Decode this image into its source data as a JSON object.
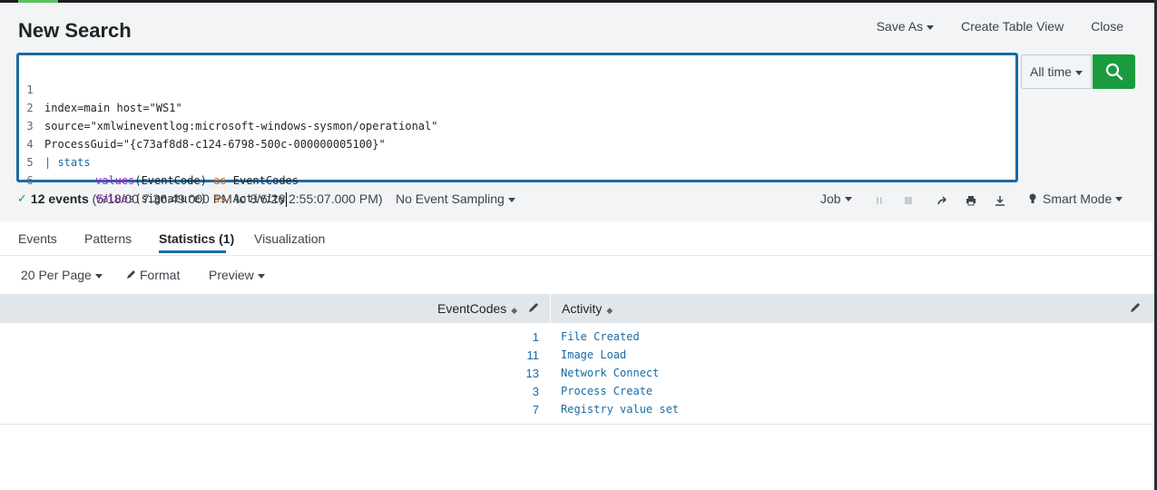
{
  "header": {
    "title": "New Search",
    "save_as": "Save As",
    "create_table_view": "Create Table View",
    "close": "Close"
  },
  "search": {
    "lines": [
      {
        "num": "1",
        "text": "index=main host=\"WS1\""
      },
      {
        "num": "2",
        "text": "source=\"xmlwineventlog:microsoft-windows-sysmon/operational\""
      },
      {
        "num": "3",
        "text": "ProcessGuid=\"{c73af8d8-c124-6798-500c-000000005100}\""
      },
      {
        "num": "4",
        "pipe": "| ",
        "cmd": "stats"
      },
      {
        "num": "5",
        "fn": "values",
        "arg": "(EventCode) ",
        "as": "as",
        "alias": " EventCodes"
      },
      {
        "num": "6",
        "fn": "values",
        "arg": "(signature) ",
        "as": "as",
        "alias": " Activity"
      }
    ],
    "time_range": "All time",
    "search_button_icon": "search-icon"
  },
  "status": {
    "events_count": "12 events",
    "range": "(5/18/00 7:36:49.000 PM to 8/6/26 2:55:07.000 PM)",
    "sampling": "No Event Sampling",
    "job": "Job",
    "mode": "Smart Mode"
  },
  "tabs": [
    {
      "label": "Events"
    },
    {
      "label": "Patterns"
    },
    {
      "label": "Statistics (1)",
      "active": true
    },
    {
      "label": "Visualization"
    }
  ],
  "toolbar": {
    "per_page": "20 Per Page",
    "format": "Format",
    "preview": "Preview"
  },
  "table": {
    "columns": [
      "EventCodes",
      "Activity"
    ],
    "rows": [
      {
        "EventCodes": "1",
        "Activity": "File Created"
      },
      {
        "EventCodes": "11",
        "Activity": "Image Load"
      },
      {
        "EventCodes": "13",
        "Activity": "Network Connect"
      },
      {
        "EventCodes": "3",
        "Activity": "Process Create"
      },
      {
        "EventCodes": "7",
        "Activity": "Registry value set"
      }
    ]
  },
  "colors": {
    "accent_blue": "#1a6aa3",
    "search_green": "#1a9c3e",
    "keyword_purple": "#a021c3",
    "keyword_orange": "#d0651d"
  }
}
